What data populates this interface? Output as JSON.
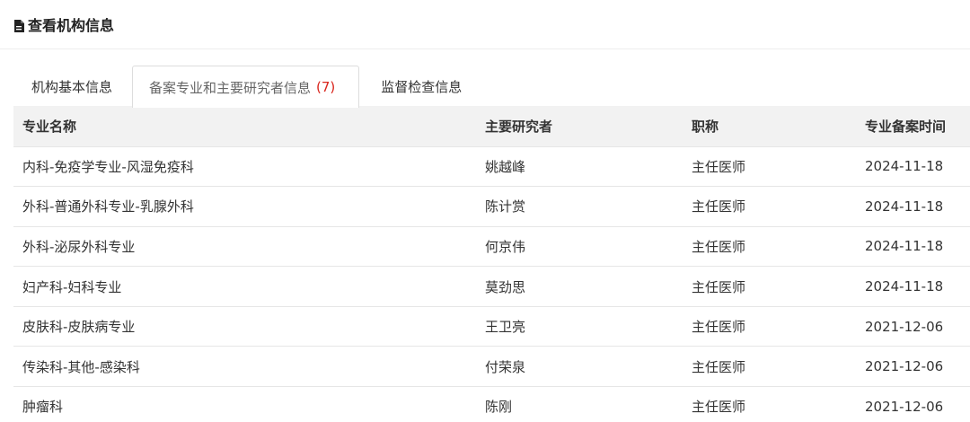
{
  "header": {
    "title": "查看机构信息",
    "icon": "document-icon"
  },
  "tabs": [
    {
      "label": "机构基本信息",
      "count": "",
      "active": false
    },
    {
      "label": "备案专业和主要研究者信息",
      "count": "(7)",
      "active": true
    },
    {
      "label": "监督检查信息",
      "count": "",
      "active": false
    }
  ],
  "colors": {
    "accent_count": "#d9251c",
    "table_header_bg": "#f2f2f2",
    "border": "#e6e6e6"
  },
  "table": {
    "columns": [
      "专业名称",
      "主要研究者",
      "职称",
      "专业备案时间"
    ],
    "rows": [
      [
        "内科-免疫学专业-风湿免疫科",
        "姚越峰",
        "主任医师",
        "2024-11-18"
      ],
      [
        "外科-普通外科专业-乳腺外科",
        "陈计赏",
        "主任医师",
        "2024-11-18"
      ],
      [
        "外科-泌尿外科专业",
        "何京伟",
        "主任医师",
        "2024-11-18"
      ],
      [
        "妇产科-妇科专业",
        "莫劲思",
        "主任医师",
        "2024-11-18"
      ],
      [
        "皮肤科-皮肤病专业",
        "王卫亮",
        "主任医师",
        "2021-12-06"
      ],
      [
        "传染科-其他-感染科",
        "付荣泉",
        "主任医师",
        "2021-12-06"
      ],
      [
        "肿瘤科",
        "陈刚",
        "主任医师",
        "2021-12-06"
      ]
    ]
  }
}
